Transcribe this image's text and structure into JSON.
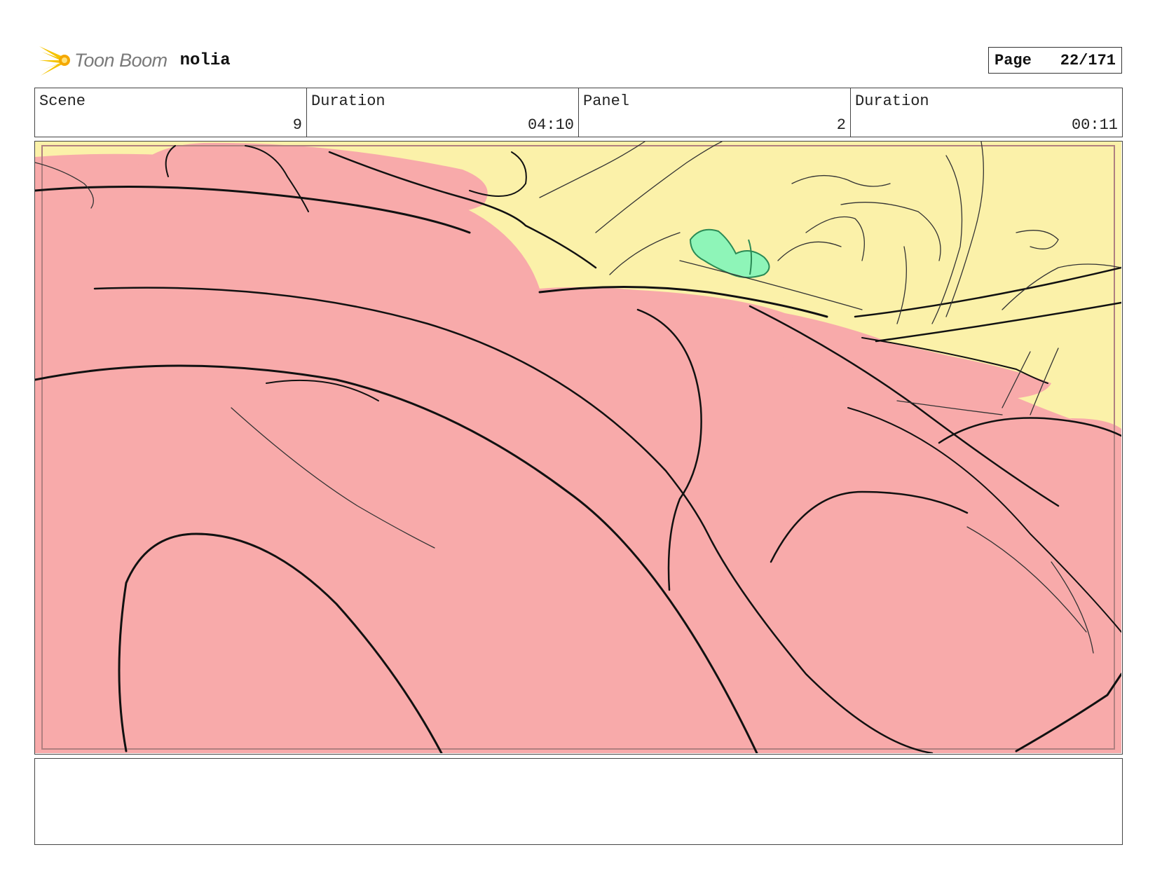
{
  "header": {
    "logo_text": "Toon Boom",
    "project_name": "nolia",
    "page_label": "Page",
    "page_number": "22/171"
  },
  "info": {
    "scene_label": "Scene",
    "scene_value": "9",
    "scene_duration_label": "Duration",
    "scene_duration_value": "04:10",
    "panel_label": "Panel",
    "panel_value": "2",
    "panel_duration_label": "Duration",
    "panel_duration_value": "00:11"
  },
  "panel": {
    "colors": {
      "background": "#fbf1a9",
      "figure": "#f8aaaa",
      "accent_green": "#8ef5b8",
      "line": "#111111"
    }
  },
  "notes": {
    "text": ""
  }
}
